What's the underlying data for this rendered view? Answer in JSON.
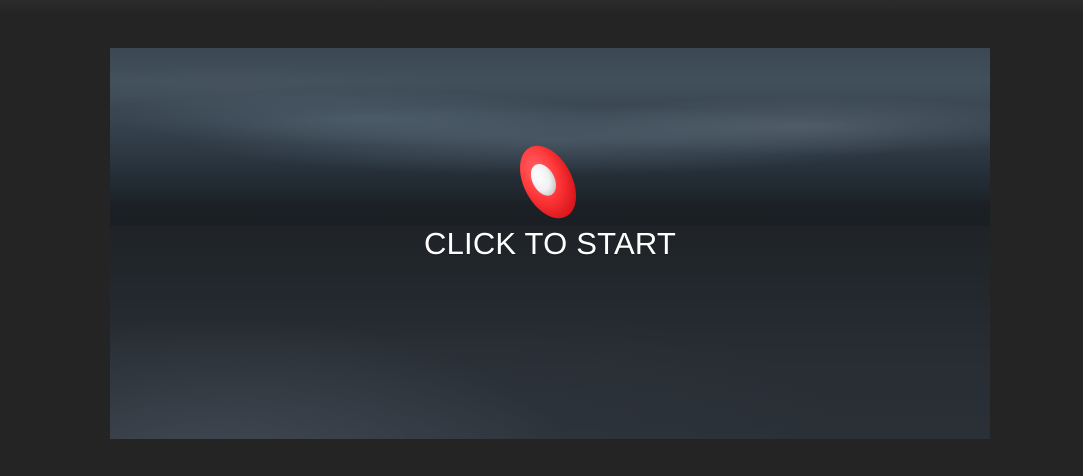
{
  "scene": {
    "overlay": {
      "start_text": "CLICK TO START"
    },
    "icons": {
      "ball": "red-ball-icon"
    }
  },
  "colors": {
    "outer_background": "#242424",
    "sky_dark": "#1c2228",
    "sky_light": "#42505c",
    "ground": "#22272c",
    "ball_red": "#ff3a3d",
    "ball_highlight": "#ffffff",
    "text": "#ffffff"
  }
}
